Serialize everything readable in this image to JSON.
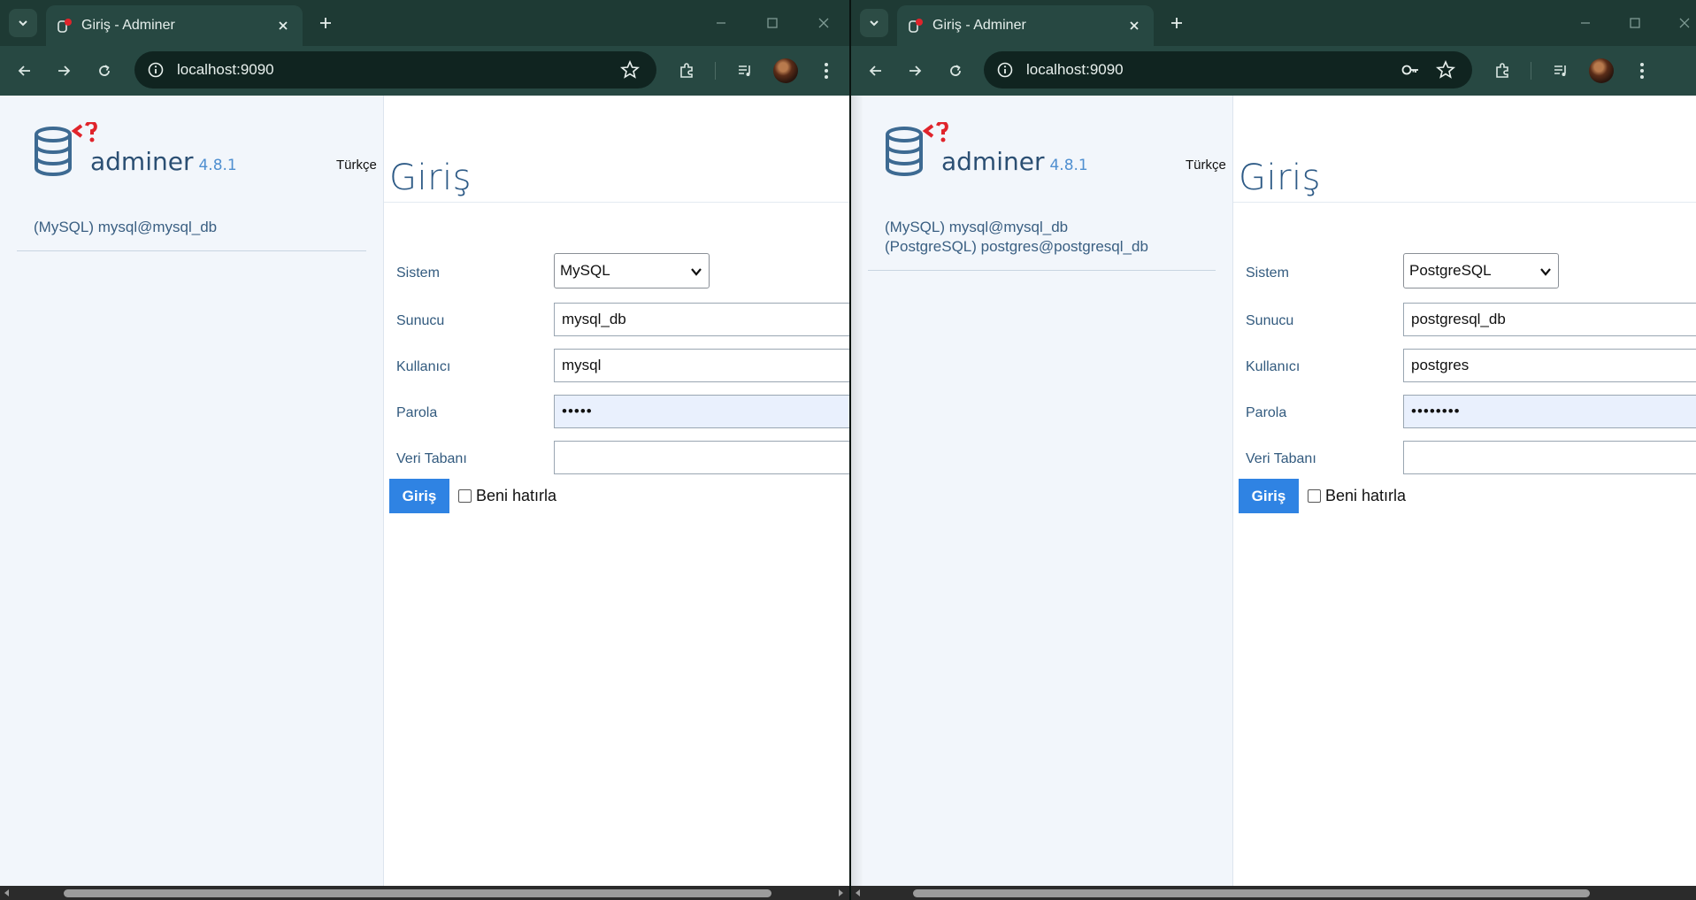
{
  "windows": [
    {
      "tab_title": "Giriş - Adminer",
      "url": "localhost:9090",
      "app": {
        "brand": "adminer",
        "version": "4.8.1",
        "language": "Türkçe"
      },
      "servers": [
        "(MySQL) mysql@mysql_db"
      ],
      "form": {
        "title": "Giriş",
        "system_label": "Sistem",
        "system_value": "MySQL",
        "server_label": "Sunucu",
        "server_value": "mysql_db",
        "user_label": "Kullanıcı",
        "user_value": "mysql",
        "password_label": "Parola",
        "password_value": "•••••",
        "database_label": "Veri Tabanı",
        "database_value": "",
        "submit_label": "Giriş",
        "remember_label": "Beni hatırla"
      }
    },
    {
      "tab_title": "Giriş - Adminer",
      "url": "localhost:9090",
      "app": {
        "brand": "adminer",
        "version": "4.8.1",
        "language": "Türkçe"
      },
      "servers": [
        "(MySQL) mysql@mysql_db",
        "(PostgreSQL) postgres@postgresql_db"
      ],
      "form": {
        "title": "Giriş",
        "system_label": "Sistem",
        "system_value": "PostgreSQL",
        "server_label": "Sunucu",
        "server_value": "postgresql_db",
        "user_label": "Kullanıcı",
        "user_value": "postgres",
        "password_label": "Parola",
        "password_value": "••••••••",
        "database_label": "Veri Tabanı",
        "database_value": "",
        "submit_label": "Giriş",
        "remember_label": "Beni hatırla"
      }
    }
  ],
  "colors": {
    "chrome_dark": "#1e3a34",
    "toolbar": "#274842",
    "sidebar_bg": "#f2f6fb",
    "link_blue": "#3a5f82",
    "button_blue": "#2f83e3",
    "password_bg": "#e9f0fd",
    "logo_red": "#e0242b"
  }
}
